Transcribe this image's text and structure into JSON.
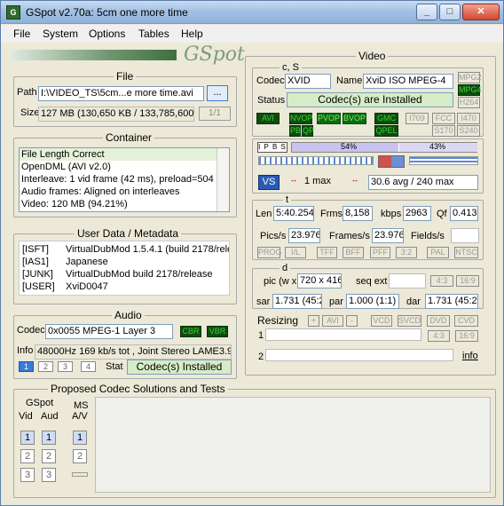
{
  "window": {
    "title": "GSpot v2.70a: 5cm one more time"
  },
  "menu": [
    "File",
    "System",
    "Options",
    "Tables",
    "Help"
  ],
  "logo": "GSpot",
  "file": {
    "legend": "File",
    "path_label": "Path",
    "path_value": "I:\\VIDEO_TS\\5cm...e more time.avi",
    "browse": "...",
    "size_label": "Size",
    "size_value": "127 MB (130,650 KB / 133,785,600",
    "count": "1/1"
  },
  "container": {
    "legend": "Container",
    "lines": [
      "File Length Correct",
      "OpenDML (AVI v2.0)",
      "Interleave: 1 vid frame (42 ms), preload=504",
      "Audio frames: Aligned on interleaves",
      "Video: 120 MB (94.21%)"
    ]
  },
  "metadata": {
    "legend": "User Data / Metadata",
    "rows": [
      [
        "[ISFT]",
        "VirtualDubMod 1.5.4.1 (build 2178/relea"
      ],
      [
        "[IAS1]",
        "Japanese"
      ],
      [
        "[JUNK]",
        "VirtualDubMod build 2178/release"
      ],
      [
        "[USER]",
        "XviD0047"
      ]
    ]
  },
  "audio": {
    "legend": "Audio",
    "codec_label": "Codec",
    "codec_value": "0x0055 MPEG-1 Layer 3",
    "cbr": "CBR",
    "vbr": "VBR",
    "info_label": "Info",
    "info_value": "48000Hz  169 kb/s tot , Joint Stereo LAME3.9",
    "tracks": [
      "1",
      "2",
      "3",
      "4"
    ],
    "stat_label": "Stat",
    "stat_value": "Codec(s) Installed"
  },
  "proposed": {
    "legend": "Proposed Codec Solutions and Tests",
    "gspot": "GSpot",
    "vid": "Vid",
    "aud": "Aud",
    "ms": "MS",
    "av": "A/V",
    "n1": "1",
    "n2": "2",
    "n3": "3"
  },
  "video": {
    "legend": "Video",
    "cs_legend": "c, S",
    "codec_label": "Codec",
    "codec_value": "XVID",
    "name_label": "Name",
    "name_value": "XviD ISO MPEG-4",
    "status_label": "Status",
    "status_value": "Codec(s) are Installed",
    "badges_right": [
      "MPG2",
      "MPG4",
      "H264"
    ],
    "row1": [
      "AVI",
      "NVOP",
      "PVOP",
      "BVOP",
      "GMC",
      "I709",
      "FCC",
      "I470"
    ],
    "row2": [
      "PB",
      "QP",
      "QPEL",
      "S170",
      "S240"
    ],
    "ipb": "I P B S",
    "pct1": "54%",
    "pct2": "43%",
    "max": "1 max",
    "avg": "30.6 avg / 240 max",
    "t_legend": "t",
    "len_label": "Len",
    "len_value": "5:40.254",
    "frms_label": "Frms",
    "frms_value": "8,158",
    "kbps_label": "kbps",
    "kbps_value": "2963",
    "qf_label": "Qf",
    "qf_value": "0.413",
    "pics_label": "Pics/s",
    "pics_value": "23.976",
    "frames_label": "Frames/s",
    "frames_value": "23.976",
    "fields_label": "Fields/s",
    "fmt": [
      "PROG",
      "I/L",
      "TFF",
      "BFF",
      "PFF",
      "3:2",
      "PAL",
      "NTSC"
    ],
    "d_legend": "d",
    "pic_label": "pic (w x",
    "pic_value": "720 x 416",
    "seq_label": "seq ext",
    "r43": "4:3",
    "r169": "16:9",
    "sar_label": "sar",
    "sar_value": "1.731 (45:26",
    "par_label": "par",
    "par_value": "1.000 (1:1)",
    "dar_label": "dar",
    "dar_value": "1.731 (45:26",
    "resizing": "Resizing",
    "rs_plus": "+",
    "rs_avi": "AVI",
    "rs_minus": "-",
    "rs_vcd": "VCD",
    "rs_svcd": "SVCD",
    "rs_dvd": "DVD",
    "rs_cvd": "CVD",
    "one": "1",
    "two": "2",
    "info": "info"
  }
}
